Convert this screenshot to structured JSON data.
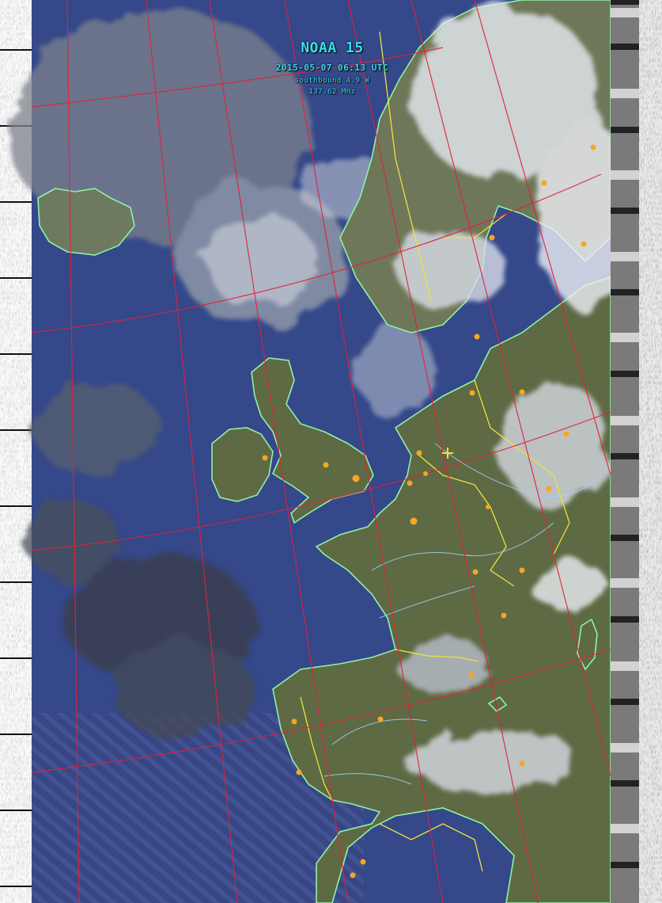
{
  "satellite": "NOAA 15",
  "pass_time": "2015-05-07 06:13 UTC",
  "pass_direction": "southbound 4.9 W",
  "frequency": "137.62 MHz",
  "colors": {
    "ocean": "#34488a",
    "land": "#5e6a44",
    "cloud": "#cfd6e6",
    "coastline": "#8ff2a8",
    "borders": "#f2e03a",
    "graticule": "#e0223a",
    "cities": "#f5a623",
    "caption": "#37e0ee"
  }
}
